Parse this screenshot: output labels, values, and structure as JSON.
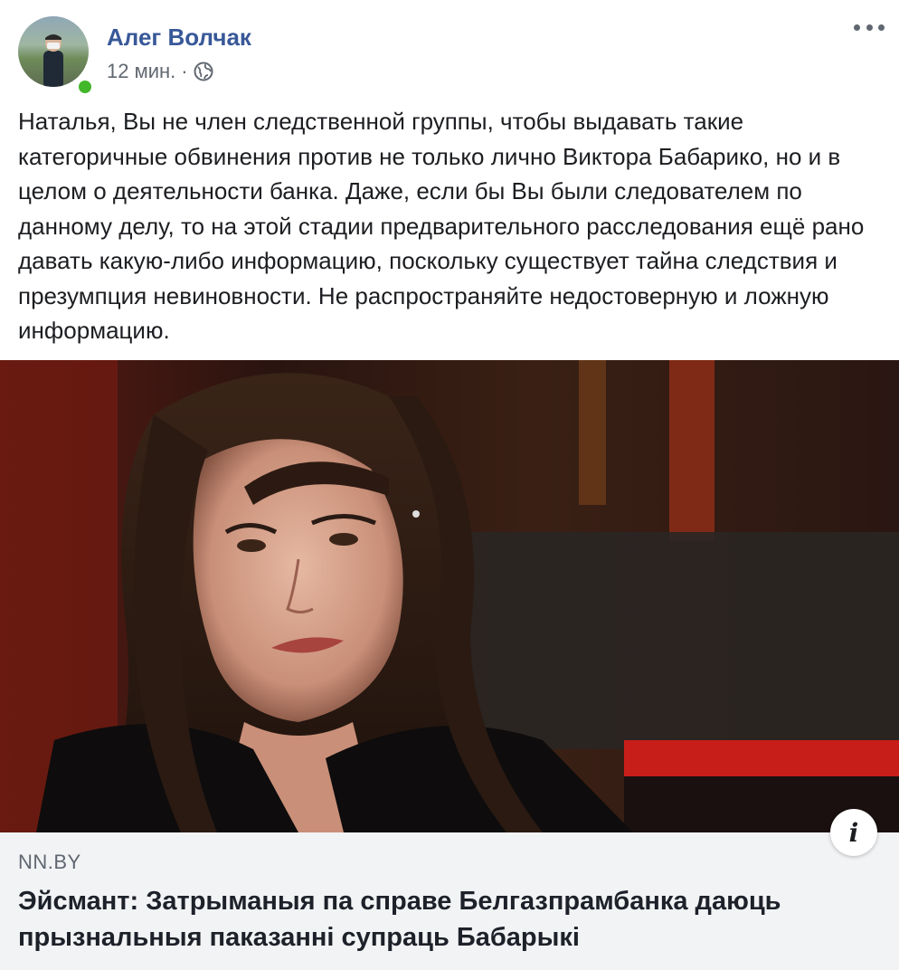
{
  "post": {
    "author": "Алег Волчак",
    "time": "12 мин.",
    "separator": "·",
    "privacy_icon": "globe-icon",
    "more_icon": "more-options-icon",
    "text": "Наталья, Вы не член следственной группы, чтобы выдавать такие категоричные обвинения против не только лично Виктора Бабарико, но и в целом о деятельности банка. Даже, если бы Вы были следователем по данному делу, то на этой стадии предварительного расследования ещё рано давать какую-либо информацию, поскольку существует тайна следствия и презумпция невиновности. Не распространяйте недостоверную и ложную информацию."
  },
  "link_preview": {
    "domain": "NN.BY",
    "title": "Эйсмант: Затрыманыя па справе Белгазпрамбанка даюць прызнальныя паказанні супраць Бабарыкі",
    "info_label": "i"
  },
  "colors": {
    "name": "#385898",
    "online": "#42b72a",
    "meta": "#606770",
    "footer_bg": "#f2f3f5"
  }
}
